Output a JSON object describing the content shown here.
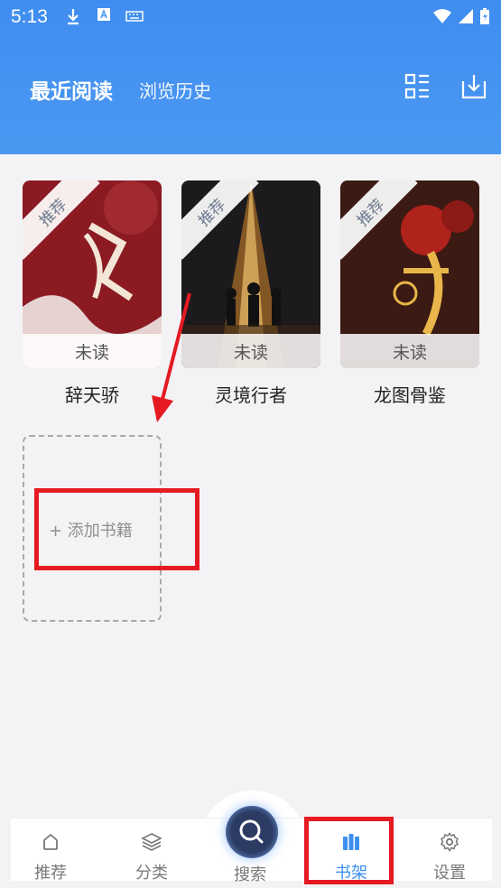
{
  "status": {
    "time": "5:13"
  },
  "header": {
    "tab_active": "最近阅读",
    "tab_other": "浏览历史"
  },
  "books": [
    {
      "title": "辞天骄",
      "badge": "推荐",
      "state": "未读"
    },
    {
      "title": "灵境行者",
      "badge": "推荐",
      "state": "未读"
    },
    {
      "title": "龙图骨鉴",
      "badge": "推荐",
      "state": "未读"
    }
  ],
  "add_book": {
    "label": "+ 添加书籍"
  },
  "nav": {
    "items": [
      {
        "label": "推荐",
        "icon": "home-icon"
      },
      {
        "label": "分类",
        "icon": "layers-icon"
      },
      {
        "label": "搜索",
        "icon": "search-icon"
      },
      {
        "label": "书架",
        "icon": "bookshelf-icon",
        "active": true
      },
      {
        "label": "设置",
        "icon": "gear-icon"
      }
    ]
  },
  "colors": {
    "accent": "#3d8ff0",
    "header": "#4b98f2",
    "highlight": "#e51a22"
  }
}
